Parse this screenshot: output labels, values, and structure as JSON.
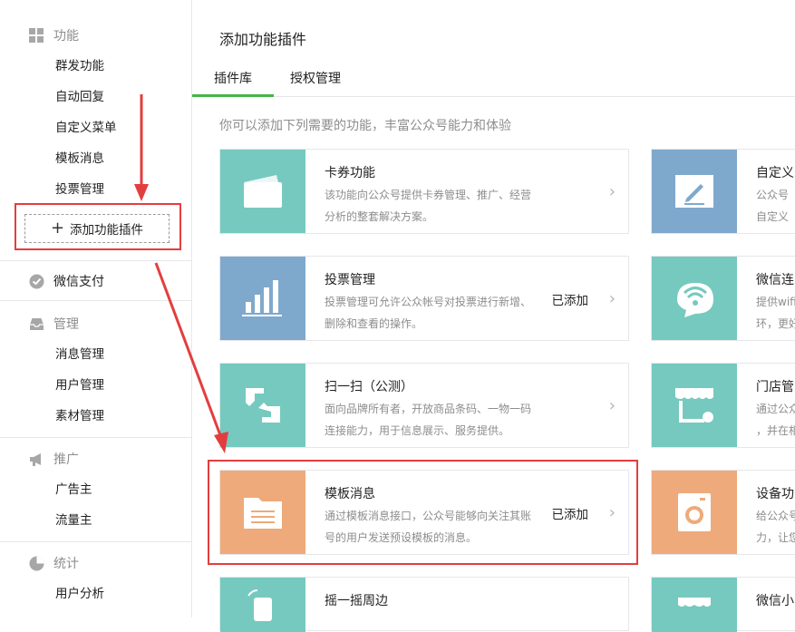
{
  "sidebar": {
    "sections": [
      {
        "title": "功能",
        "items": [
          "群发功能",
          "自动回复",
          "自定义菜单",
          "模板消息",
          "投票管理"
        ]
      },
      {
        "title": "微信支付",
        "items": []
      },
      {
        "title": "管理",
        "items": [
          "消息管理",
          "用户管理",
          "素材管理"
        ]
      },
      {
        "title": "推广",
        "items": [
          "广告主",
          "流量主"
        ]
      },
      {
        "title": "统计",
        "items": [
          "用户分析"
        ]
      }
    ],
    "add_plugin_label": "添加功能插件"
  },
  "main": {
    "title": "添加功能插件",
    "tabs": [
      {
        "label": "插件库",
        "active": true
      },
      {
        "label": "授权管理",
        "active": false
      }
    ],
    "subtitle": "你可以添加下列需要的功能，丰富公众号能力和体验",
    "cards_left": [
      {
        "title": "卡券功能",
        "desc1": "该功能向公众号提供卡券管理、推广、经营",
        "desc2": "分析的整套解决方案。",
        "status": "",
        "color": "#76c9bf",
        "icon": "card-icon"
      },
      {
        "title": "投票管理",
        "desc1": "投票管理可允许公众帐号对投票进行新增、",
        "desc2": "删除和查看的操作。",
        "status": "已添加",
        "color": "#7fa9cc",
        "icon": "bar-chart-icon"
      },
      {
        "title": "扫一扫（公测）",
        "desc1": "面向品牌所有者，开放商品条码、一物一码",
        "desc2": "连接能力，用于信息展示、服务提供。",
        "status": "",
        "color": "#76c9bf",
        "icon": "scan-icon"
      },
      {
        "title": "模板消息",
        "desc1": "通过模板消息接口，公众号能够向关注其账",
        "desc2": "号的用户发送预设模板的消息。",
        "status": "已添加",
        "color": "#eeaa7a",
        "icon": "folder-icon"
      },
      {
        "title": "摇一摇周边",
        "desc1": "",
        "desc2": "",
        "status": "",
        "color": "#76c9bf",
        "icon": "shake-icon"
      }
    ],
    "cards_right": [
      {
        "title": "自定义",
        "desc1": "公众号",
        "desc2": "自定义",
        "color": "#7fa9cc",
        "icon": "edit-icon"
      },
      {
        "title": "微信连",
        "desc1": "提供wifi",
        "desc2": "环，更好",
        "color": "#76c9bf",
        "icon": "wifi-icon"
      },
      {
        "title": "门店管",
        "desc1": "通过公众",
        "desc2": "，并在相",
        "color": "#76c9bf",
        "icon": "store-icon"
      },
      {
        "title": "设备功",
        "desc1": "给公众号",
        "desc2": "力，让您",
        "color": "#eeaa7a",
        "icon": "device-icon"
      },
      {
        "title": "微信小",
        "desc1": "",
        "desc2": "",
        "color": "#76c9bf",
        "icon": "store2-icon"
      }
    ]
  }
}
